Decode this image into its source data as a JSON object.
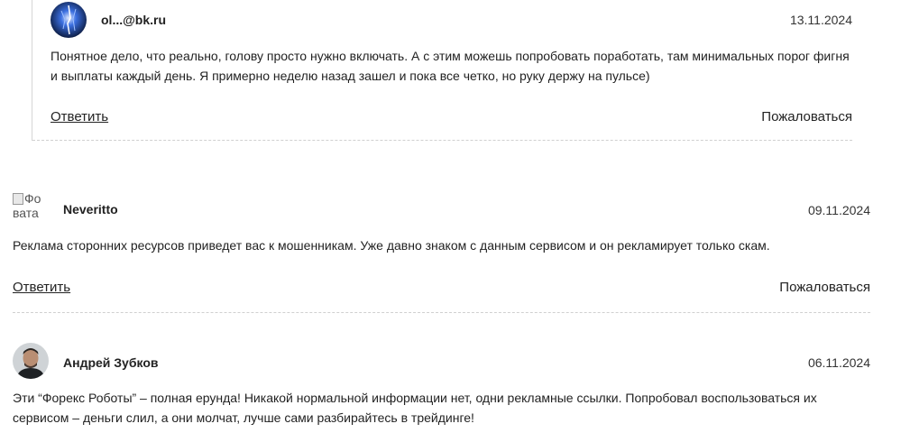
{
  "comments": [
    {
      "author": "ol...@bk.ru",
      "date": "13.11.2024",
      "text_line1": "Понятное дело, что реально, голову просто нужно включать. А с этим можешь попробовать поработать, там минимальных порог фигня",
      "text_line2": "и выплаты каждый день. Я примерно неделю назад зашел и пока все четко, но руку держу на пульсе)",
      "reply_label": "Ответить",
      "complain_label": "Пожаловаться"
    },
    {
      "author": "Neveritto",
      "avatar_alt": "Фо\nвата",
      "date": "09.11.2024",
      "text_line1": "Реклама сторонних ресурсов приведет вас к мошенникам. Уже давно знаком с данным сервисом и он рекламирует только скам.",
      "reply_label": "Ответить",
      "complain_label": "Пожаловаться"
    },
    {
      "author": "Андрей Зубков",
      "date": "06.11.2024",
      "text_line1": "Эти “Форекс Роботы” – полная ерунда! Никакой нормальной информации нет, одни рекламные ссылки. Попробовал воспользоваться их",
      "text_line2": "сервисом – деньги слил, а они молчат, лучше сами разбирайтесь в трейдинге!"
    }
  ],
  "avatar_alt_line1": "Фо",
  "avatar_alt_line2": "вата"
}
